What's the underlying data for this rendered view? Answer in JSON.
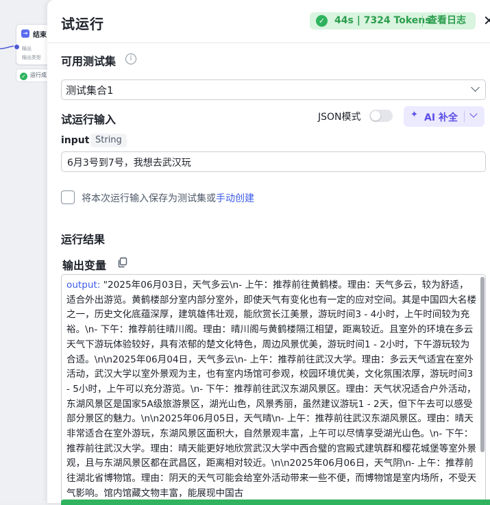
{
  "canvas": {
    "node": {
      "title": "结束",
      "row1": "输出",
      "row2": "输出类型"
    },
    "run_pill": {
      "label": "运行成"
    }
  },
  "header": {
    "title": "试运行",
    "status": {
      "duration": "44s",
      "tokens": "7324 Tokens",
      "log_link": "查看日志"
    }
  },
  "test_set": {
    "label": "可用测试集",
    "selected": "测试集合1"
  },
  "input_section": {
    "label": "试运行输入",
    "json_mode_label": "JSON模式",
    "json_mode_on": false,
    "ai_button_label": "AI 补全",
    "field": {
      "name": "input",
      "type": "String",
      "value": "6月3号到7号，我想去武汉玩"
    }
  },
  "save_option": {
    "checked": false,
    "text": "将本次运行输入保存为测试集或",
    "link": "手动创建"
  },
  "results": {
    "label": "运行结果",
    "output_label": "输出变量",
    "output_key": "output",
    "output_value": "\"2025年06月03日，天气多云\\n- 上午：推荐前往黄鹤楼。理由：天气多云，较为舒适，适合外出游览。黄鹤楼部分室内部分室外，即使天气有变化也有一定的应对空间。其是中国四大名楼之一，历史文化底蕴深厚，建筑雄伟壮观，能欣赏长江美景，游玩时间3 - 4小时，上午时间较为充裕。\\n- 下午：推荐前往晴川阁。理由：晴川阁与黄鹤楼隔江相望，距离较近。且室外的环境在多云天气下游玩体验较好，具有浓郁的楚文化特色，周边风景优美，游玩时间1 - 2小时，下午游玩较为合适。\\n\\n2025年06月04日，天气多云\\n- 上午：推荐前往武汉大学。理由：多云天气适宜在室外活动，武汉大学以室外景观为主，也有室内场馆可参观，校园环境优美，文化氛围浓厚，游玩时间3 - 5小时，上午可以充分游览。\\n- 下午：推荐前往武汉东湖风景区。理由：天气状况适合户外活动，东湖风景区是国家5A级旅游景区，湖光山色，风景秀丽，虽然建议游玩1 - 2天，但下午去可以感受部分景区的魅力。\\n\\n2025年06月05日，天气晴\\n- 上午：推荐前往武汉东湖风景区。理由：晴天非常适合在室外游玩，东湖风景区面积大，自然景观丰富，上午可以尽情享受湖光山色。\\n- 下午：推荐前往武汉大学。理由：晴天能更好地欣赏武汉大学中西合璧的宫殿式建筑群和樱花城堡等室外景观，且与东湖风景区都在武昌区，距离相对较近。\\n\\n2025年06月06日，天气阴\\n- 上午：推荐前往湖北省博物馆。理由：阴天的天气可能会给室外活动带来一些不便，而博物馆是室内场所，不受天气影响。馆内馆藏文物丰富，能展现中国古"
  },
  "colors": {
    "accent": "#3d5ce8",
    "success": "#2fb35e",
    "ai": "#5b4ee6"
  }
}
